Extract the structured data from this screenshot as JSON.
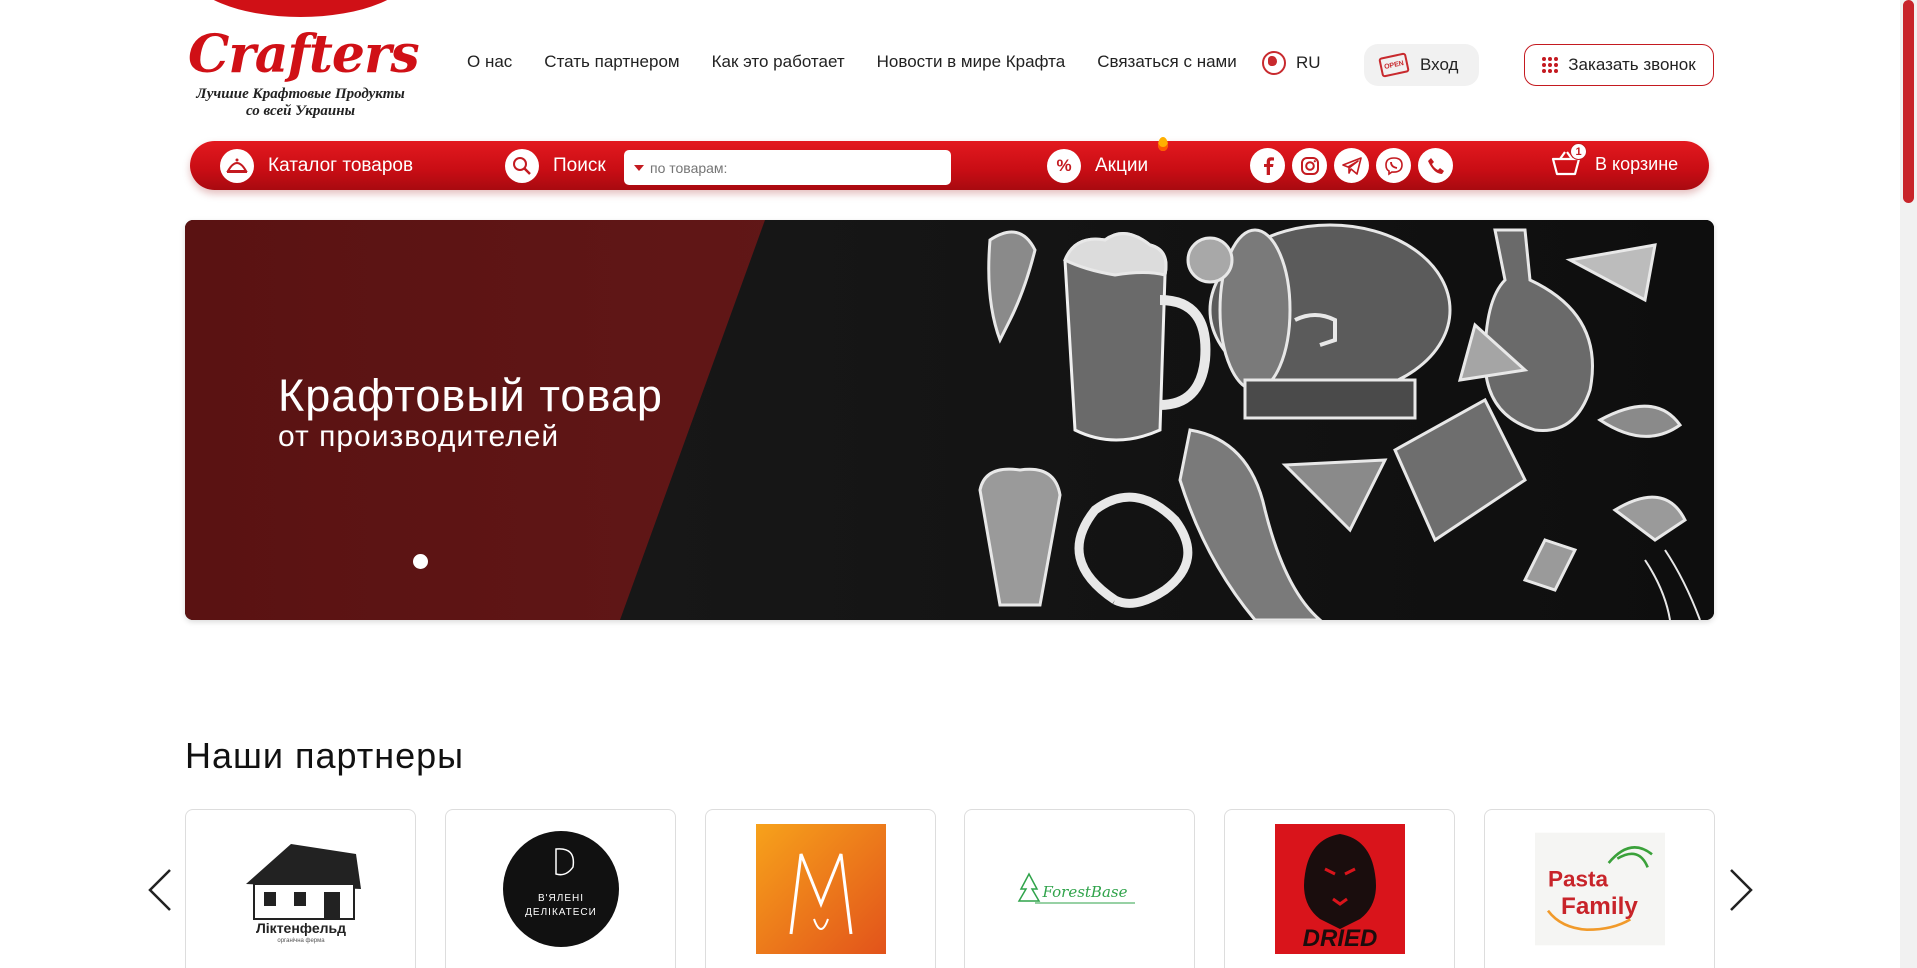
{
  "logo": {
    "name": "Crafters",
    "tagline_line1": "Лучшие Крафтовые Продукты",
    "tagline_line2": "со всей Украины"
  },
  "nav": {
    "items": [
      "О нас",
      "Стать партнером",
      "Как это работает",
      "Новости в мире Крафта",
      "Связаться с нами"
    ]
  },
  "language": {
    "current": "RU"
  },
  "login": {
    "label": "Вход",
    "sign_text": "OPEN"
  },
  "callback": {
    "label": "Заказать звонок"
  },
  "redbar": {
    "catalog_label": "Каталог товаров",
    "search_label": "Поиск",
    "search_placeholder": "по товарам:",
    "promo_label": "Акции",
    "promo_icon_text": "%",
    "cart_label": "В корзине",
    "cart_count": "1"
  },
  "social_icons": [
    "facebook-icon",
    "instagram-icon",
    "telegram-icon",
    "viber-icon",
    "phone-icon"
  ],
  "hero": {
    "title": "Крафтовый товар",
    "subtitle": "от производителей"
  },
  "partners": {
    "title": "Наши партнеры",
    "items": [
      {
        "name": "Ліктенфельд",
        "caption": "органічна ферма"
      },
      {
        "name": "В'ЯЛЕНІ ДЕЛІКАТЕСИ"
      },
      {
        "name": "M"
      },
      {
        "name": "ForestBase"
      },
      {
        "name": "DRIED"
      },
      {
        "name": "Pasta Family"
      }
    ]
  },
  "colors": {
    "brand_red": "#d01016",
    "dark_red": "#5a1212"
  }
}
